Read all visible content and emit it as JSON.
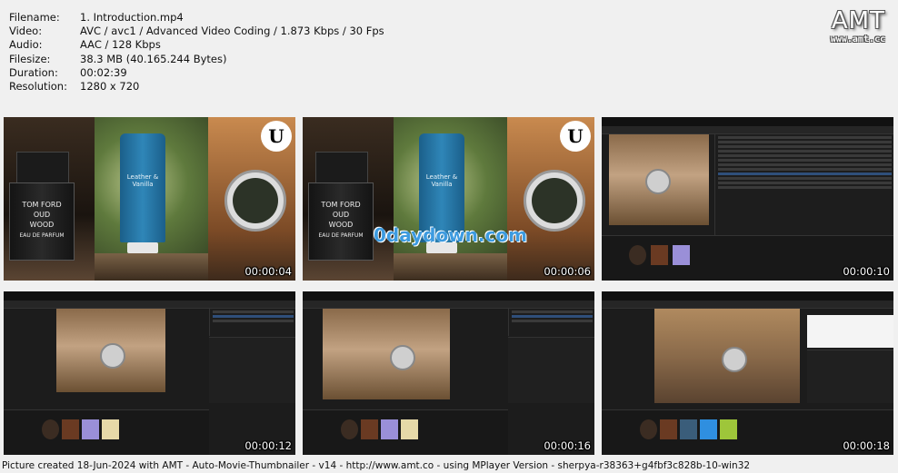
{
  "meta": {
    "rows": [
      {
        "key": "Filename:",
        "value": "1. Introduction.mp4"
      },
      {
        "key": "Video:",
        "value": "AVC / avc1 / Advanced Video Coding / 1.873 Kbps / 30 Fps"
      },
      {
        "key": "Audio:",
        "value": "AAC / 128 Kbps"
      },
      {
        "key": "Filesize:",
        "value": "38.3 MB (40.165.244 Bytes)"
      },
      {
        "key": "Duration:",
        "value": "00:02:39"
      },
      {
        "key": "Resolution:",
        "value": "1280 x 720"
      }
    ]
  },
  "logo": {
    "big": "AMT",
    "small": "www.amt.cc"
  },
  "thumbs": [
    {
      "time": "00:00:04",
      "kind": "collage"
    },
    {
      "time": "00:00:06",
      "kind": "collage-watermark"
    },
    {
      "time": "00:00:10",
      "kind": "editor"
    },
    {
      "time": "00:00:12",
      "kind": "editor"
    },
    {
      "time": "00:00:16",
      "kind": "editor"
    },
    {
      "time": "00:00:18",
      "kind": "editor"
    }
  ],
  "collage": {
    "bottle_text": "TOM FORD\nOUD\nWOOD",
    "bottle_sub": "EAU DE PARFUM",
    "tube_text": "Leather &\nVanilla",
    "ue_glyph": "U",
    "watermark": "0daydown.com"
  },
  "footer": "Picture created 18-Jun-2024 with AMT - Auto-Movie-Thumbnailer - v14 - http://www.amt.co - using MPlayer Version - sherpya-r38363+g4fbf3c828b-10-win32",
  "colors": {
    "accent": "#3d9be0",
    "background": "#f0f0f0"
  }
}
